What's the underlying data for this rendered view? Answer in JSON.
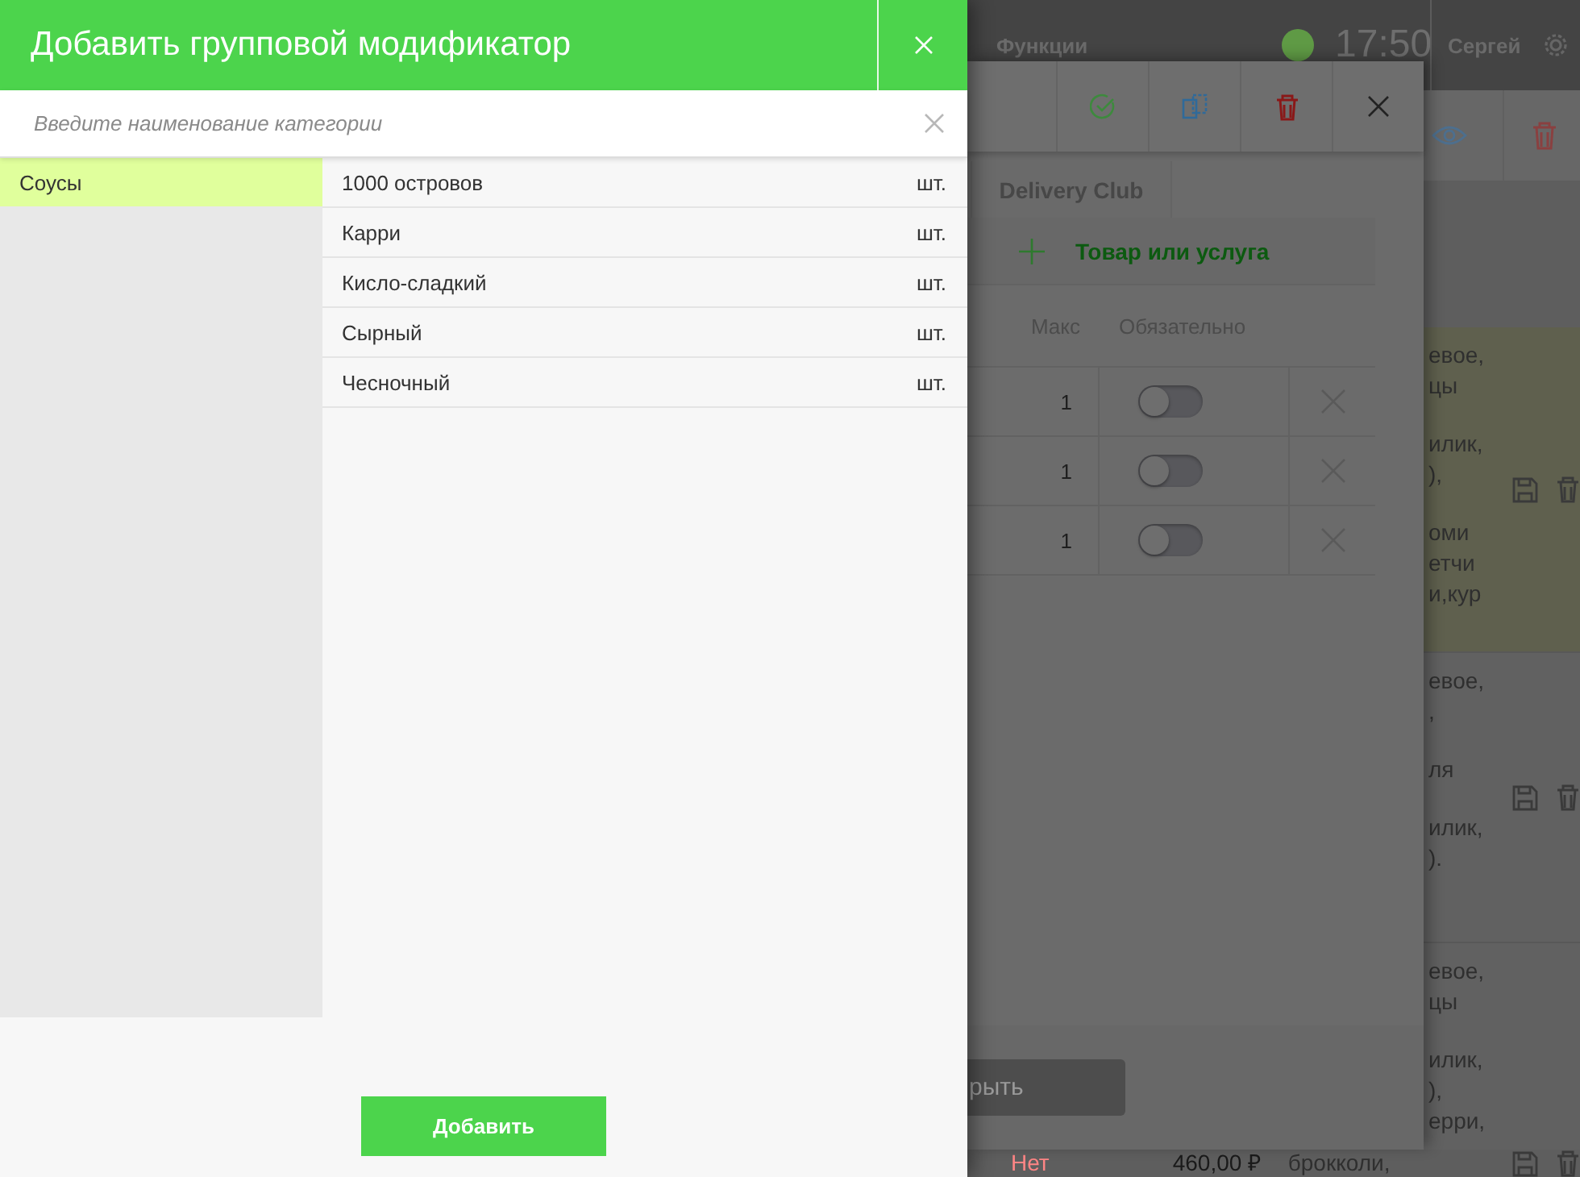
{
  "top_bar": {
    "menu_label": "Функции",
    "time": "17:50",
    "user": "Сергей"
  },
  "background_dialog": {
    "tab": "Delivery Club",
    "add_item_label": "Товар или услуга",
    "columns": [
      "Макс",
      "Обязательно"
    ],
    "rows": [
      {
        "max": "1",
        "required": false
      },
      {
        "max": "1",
        "required": false
      },
      {
        "max": "1",
        "required": false
      }
    ],
    "footer_button": "рыть"
  },
  "background_list": {
    "rows": [
      {
        "highlighted": true,
        "has_actions": true,
        "paragraphs": [
          [
            "евое,",
            "цы"
          ],
          [
            "илик,",
            "),"
          ],
          [
            "оми",
            "етчи",
            "и,кур"
          ]
        ]
      },
      {
        "highlighted": false,
        "has_actions": true,
        "paragraphs": [
          [
            "евое,",
            ","
          ],
          [
            "ля"
          ],
          [
            "илик,",
            ")."
          ]
        ]
      },
      {
        "highlighted": false,
        "has_actions": false,
        "paragraphs": [
          [
            "евое,",
            "цы"
          ],
          [
            "илик,",
            "),",
            "ерри,"
          ]
        ]
      }
    ],
    "last_row": {
      "status": "Нет",
      "price": "460,00 ₽",
      "description": "брокколи,"
    }
  },
  "drawer": {
    "title": "Добавить групповой модификатор",
    "search": {
      "placeholder": "Введите наименование категории"
    },
    "categories": [
      {
        "label": "Соусы",
        "selected": true
      }
    ],
    "items": [
      {
        "name": "1000 островов",
        "unit": "шт."
      },
      {
        "name": "Карри",
        "unit": "шт."
      },
      {
        "name": "Кисло-сладкий",
        "unit": "шт."
      },
      {
        "name": "Сырный",
        "unit": "шт."
      },
      {
        "name": "Чесночный",
        "unit": "шт."
      }
    ],
    "add_button": "Добавить"
  }
}
